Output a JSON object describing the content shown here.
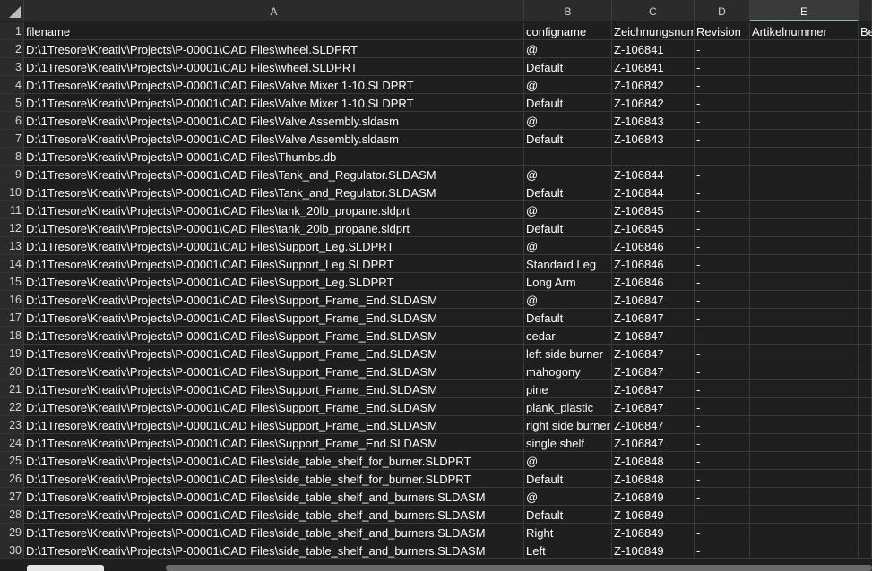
{
  "columns": [
    {
      "letter": "A",
      "selected": false
    },
    {
      "letter": "B",
      "selected": false
    },
    {
      "letter": "C",
      "selected": false
    },
    {
      "letter": "D",
      "selected": false
    },
    {
      "letter": "E",
      "selected": true
    },
    {
      "letter": "",
      "selected": false
    }
  ],
  "rows": [
    {
      "num": "1",
      "cells": [
        "filename",
        "configname",
        "Zeichnungsnummer",
        "Revision",
        "Artikelnummer",
        "Bezeichnung"
      ]
    },
    {
      "num": "2",
      "cells": [
        "D:\\1Tresore\\Kreativ\\Projects\\P-00001\\CAD Files\\wheel.SLDPRT",
        "@",
        "Z-106841",
        "-",
        "",
        ""
      ]
    },
    {
      "num": "3",
      "cells": [
        "D:\\1Tresore\\Kreativ\\Projects\\P-00001\\CAD Files\\wheel.SLDPRT",
        "Default",
        "Z-106841",
        "-",
        "",
        ""
      ]
    },
    {
      "num": "4",
      "cells": [
        "D:\\1Tresore\\Kreativ\\Projects\\P-00001\\CAD Files\\Valve Mixer 1-10.SLDPRT",
        "@",
        "Z-106842",
        "-",
        "",
        ""
      ]
    },
    {
      "num": "5",
      "cells": [
        "D:\\1Tresore\\Kreativ\\Projects\\P-00001\\CAD Files\\Valve Mixer 1-10.SLDPRT",
        "Default",
        "Z-106842",
        "-",
        "",
        ""
      ]
    },
    {
      "num": "6",
      "cells": [
        "D:\\1Tresore\\Kreativ\\Projects\\P-00001\\CAD Files\\Valve Assembly.sldasm",
        "@",
        "Z-106843",
        "-",
        "",
        ""
      ]
    },
    {
      "num": "7",
      "cells": [
        "D:\\1Tresore\\Kreativ\\Projects\\P-00001\\CAD Files\\Valve Assembly.sldasm",
        "Default",
        "Z-106843",
        "-",
        "",
        ""
      ]
    },
    {
      "num": "8",
      "cells": [
        "D:\\1Tresore\\Kreativ\\Projects\\P-00001\\CAD Files\\Thumbs.db",
        "",
        "",
        "",
        "",
        ""
      ]
    },
    {
      "num": "9",
      "cells": [
        "D:\\1Tresore\\Kreativ\\Projects\\P-00001\\CAD Files\\Tank_and_Regulator.SLDASM",
        "@",
        "Z-106844",
        "-",
        "",
        ""
      ]
    },
    {
      "num": "10",
      "cells": [
        "D:\\1Tresore\\Kreativ\\Projects\\P-00001\\CAD Files\\Tank_and_Regulator.SLDASM",
        "Default",
        "Z-106844",
        "-",
        "",
        ""
      ]
    },
    {
      "num": "11",
      "cells": [
        "D:\\1Tresore\\Kreativ\\Projects\\P-00001\\CAD Files\\tank_20lb_propane.sldprt",
        "@",
        "Z-106845",
        "-",
        "",
        ""
      ]
    },
    {
      "num": "12",
      "cells": [
        "D:\\1Tresore\\Kreativ\\Projects\\P-00001\\CAD Files\\tank_20lb_propane.sldprt",
        "Default",
        "Z-106845",
        "-",
        "",
        ""
      ]
    },
    {
      "num": "13",
      "cells": [
        "D:\\1Tresore\\Kreativ\\Projects\\P-00001\\CAD Files\\Support_Leg.SLDPRT",
        "@",
        "Z-106846",
        "-",
        "",
        ""
      ]
    },
    {
      "num": "14",
      "cells": [
        "D:\\1Tresore\\Kreativ\\Projects\\P-00001\\CAD Files\\Support_Leg.SLDPRT",
        "Standard Leg",
        "Z-106846",
        "-",
        "",
        ""
      ]
    },
    {
      "num": "15",
      "cells": [
        "D:\\1Tresore\\Kreativ\\Projects\\P-00001\\CAD Files\\Support_Leg.SLDPRT",
        "Long Arm",
        "Z-106846",
        "-",
        "",
        ""
      ]
    },
    {
      "num": "16",
      "cells": [
        "D:\\1Tresore\\Kreativ\\Projects\\P-00001\\CAD Files\\Support_Frame_End.SLDASM",
        "@",
        "Z-106847",
        "-",
        "",
        ""
      ]
    },
    {
      "num": "17",
      "cells": [
        "D:\\1Tresore\\Kreativ\\Projects\\P-00001\\CAD Files\\Support_Frame_End.SLDASM",
        "Default",
        "Z-106847",
        "-",
        "",
        ""
      ]
    },
    {
      "num": "18",
      "cells": [
        "D:\\1Tresore\\Kreativ\\Projects\\P-00001\\CAD Files\\Support_Frame_End.SLDASM",
        "cedar",
        "Z-106847",
        "-",
        "",
        ""
      ]
    },
    {
      "num": "19",
      "cells": [
        "D:\\1Tresore\\Kreativ\\Projects\\P-00001\\CAD Files\\Support_Frame_End.SLDASM",
        "left side burner",
        "Z-106847",
        "-",
        "",
        ""
      ]
    },
    {
      "num": "20",
      "cells": [
        "D:\\1Tresore\\Kreativ\\Projects\\P-00001\\CAD Files\\Support_Frame_End.SLDASM",
        "mahogony",
        "Z-106847",
        "-",
        "",
        ""
      ]
    },
    {
      "num": "21",
      "cells": [
        "D:\\1Tresore\\Kreativ\\Projects\\P-00001\\CAD Files\\Support_Frame_End.SLDASM",
        "pine",
        "Z-106847",
        "-",
        "",
        ""
      ]
    },
    {
      "num": "22",
      "cells": [
        "D:\\1Tresore\\Kreativ\\Projects\\P-00001\\CAD Files\\Support_Frame_End.SLDASM",
        "plank_plastic",
        "Z-106847",
        "-",
        "",
        ""
      ]
    },
    {
      "num": "23",
      "cells": [
        "D:\\1Tresore\\Kreativ\\Projects\\P-00001\\CAD Files\\Support_Frame_End.SLDASM",
        "right side burner",
        "Z-106847",
        "-",
        "",
        ""
      ]
    },
    {
      "num": "24",
      "cells": [
        "D:\\1Tresore\\Kreativ\\Projects\\P-00001\\CAD Files\\Support_Frame_End.SLDASM",
        "single shelf",
        "Z-106847",
        "-",
        "",
        ""
      ]
    },
    {
      "num": "25",
      "cells": [
        "D:\\1Tresore\\Kreativ\\Projects\\P-00001\\CAD Files\\side_table_shelf_for_burner.SLDPRT",
        "@",
        "Z-106848",
        "-",
        "",
        ""
      ]
    },
    {
      "num": "26",
      "cells": [
        "D:\\1Tresore\\Kreativ\\Projects\\P-00001\\CAD Files\\side_table_shelf_for_burner.SLDPRT",
        "Default",
        "Z-106848",
        "-",
        "",
        ""
      ]
    },
    {
      "num": "27",
      "cells": [
        "D:\\1Tresore\\Kreativ\\Projects\\P-00001\\CAD Files\\side_table_shelf_and_burners.SLDASM",
        "@",
        "Z-106849",
        "-",
        "",
        ""
      ]
    },
    {
      "num": "28",
      "cells": [
        "D:\\1Tresore\\Kreativ\\Projects\\P-00001\\CAD Files\\side_table_shelf_and_burners.SLDASM",
        "Default",
        "Z-106849",
        "-",
        "",
        ""
      ]
    },
    {
      "num": "29",
      "cells": [
        "D:\\1Tresore\\Kreativ\\Projects\\P-00001\\CAD Files\\side_table_shelf_and_burners.SLDASM",
        "Right",
        "Z-106849",
        "-",
        "",
        ""
      ]
    },
    {
      "num": "30",
      "cells": [
        "D:\\1Tresore\\Kreativ\\Projects\\P-00001\\CAD Files\\side_table_shelf_and_burners.SLDASM",
        "Left",
        "Z-106849",
        "-",
        "",
        ""
      ]
    }
  ]
}
